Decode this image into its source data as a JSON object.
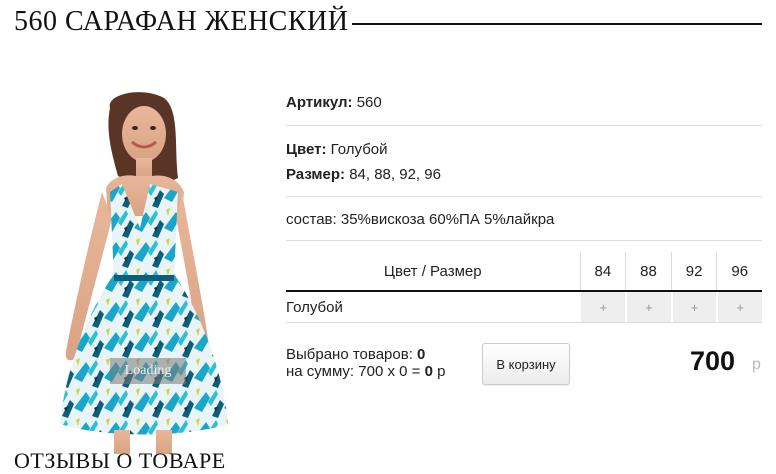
{
  "product": {
    "title": "560 САРАФАН ЖЕНСКИЙ",
    "sku_label": "Артикул:",
    "sku_value": "560",
    "color_label": "Цвет:",
    "color_value": "Голубой",
    "size_label": "Размер:",
    "size_value": "84, 88, 92, 96",
    "composition": "состав: 35%вискоза 60%ПА 5%лайкра",
    "loading_text": "Loading"
  },
  "size_table": {
    "header": "Цвет / Размер",
    "sizes": [
      "84",
      "88",
      "92",
      "96"
    ],
    "row_color": "Голубой",
    "cell_symbol": "+"
  },
  "order": {
    "selected_label": "Выбрано товаров:",
    "selected_count": "0",
    "sum_label": "на сумму: 700 х 0 =",
    "sum_value": "0",
    "currency_short": "р",
    "cart_button": "В корзину",
    "price": "700",
    "price_currency": "р"
  },
  "bottom": {
    "heading": "ОТЗЫВЫ О ТОВАРЕ"
  },
  "colors": {
    "dress_primary": "#1aa6c8",
    "dress_dark": "#0a5f7a"
  }
}
